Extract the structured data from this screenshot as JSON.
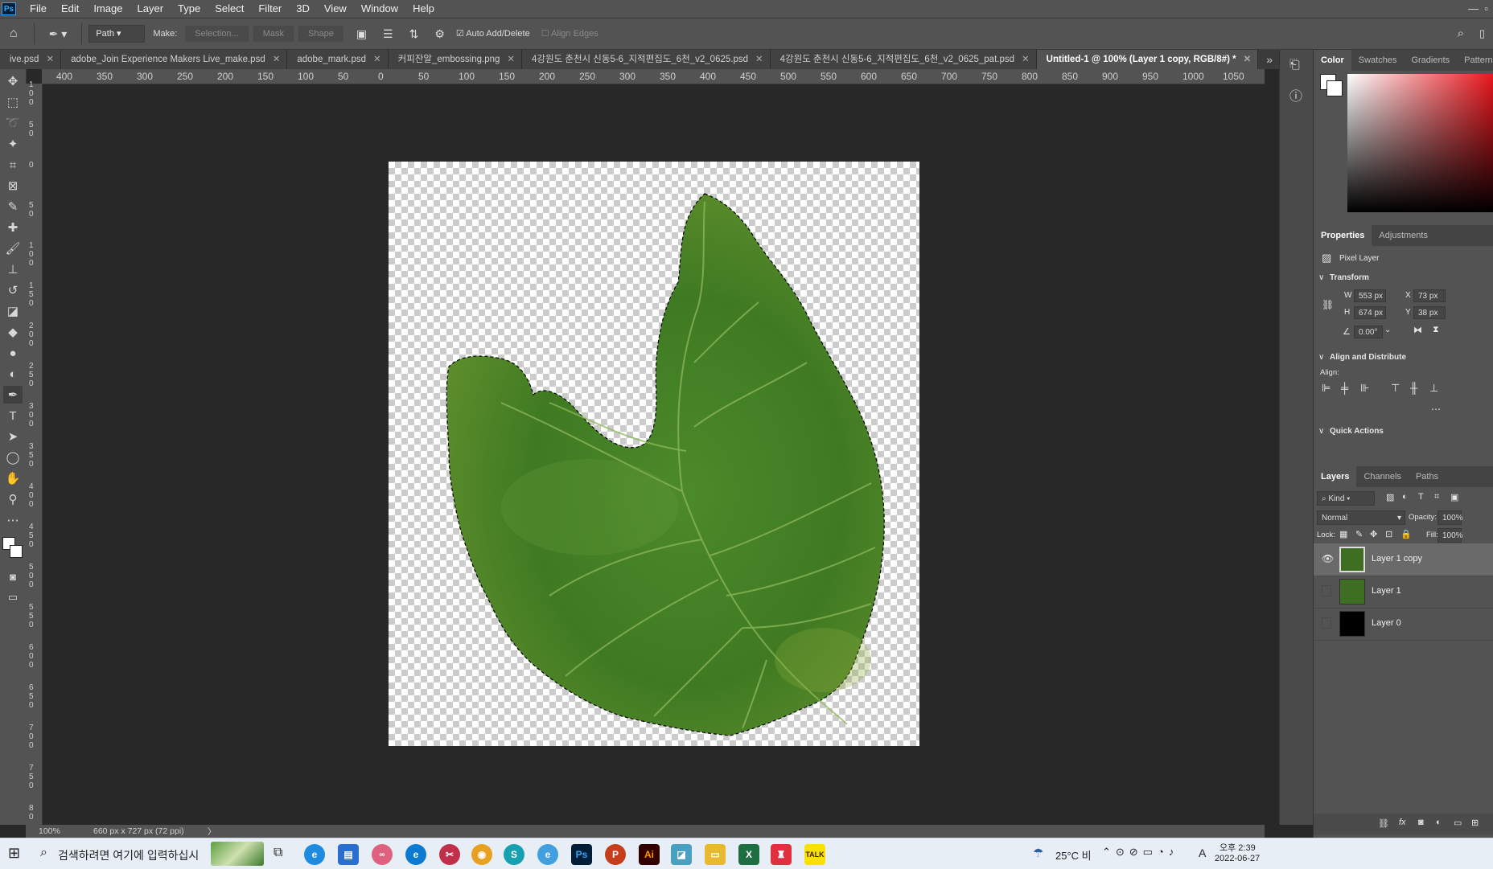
{
  "app": {
    "logo": "Ps"
  },
  "menu": [
    "File",
    "Edit",
    "Image",
    "Layer",
    "Type",
    "Select",
    "Filter",
    "3D",
    "View",
    "Window",
    "Help"
  ],
  "options": {
    "mode": "Path",
    "make_label": "Make:",
    "selection_btn": "Selection...",
    "mask_btn": "Mask",
    "shape_btn": "Shape",
    "auto_add_delete": "Auto Add/Delete",
    "align_edges": "Align Edges"
  },
  "tabs": [
    {
      "label": "ive.psd",
      "active": false
    },
    {
      "label": "adobe_Join Experience Makers Live_make.psd",
      "active": false
    },
    {
      "label": "adobe_mark.psd",
      "active": false
    },
    {
      "label": "커피잔알_embossing.png",
      "active": false
    },
    {
      "label": "4강원도 춘천시 신동5-6_지적편집도_6천_v2_0625.psd",
      "active": false
    },
    {
      "label": "4강원도 춘천시 신동5-6_지적편집도_6천_v2_0625_pat.psd",
      "active": false
    },
    {
      "label": "Untitled-1 @ 100% (Layer 1 copy, RGB/8#) *",
      "active": true
    }
  ],
  "ruler_h": [
    "400",
    "350",
    "300",
    "250",
    "200",
    "150",
    "100",
    "50",
    "0",
    "50",
    "100",
    "150",
    "200",
    "250",
    "300",
    "350",
    "400",
    "450",
    "500",
    "550",
    "600",
    "650",
    "700",
    "750",
    "800",
    "850",
    "900",
    "950",
    "1000",
    "1050"
  ],
  "ruler_v": [
    "1\n0\n0",
    "5\n0",
    "0",
    "5\n0",
    "1\n0\n0",
    "1\n5\n0",
    "2\n0\n0",
    "2\n5\n0",
    "3\n0\n0",
    "3\n5\n0",
    "4\n0\n0",
    "4\n5\n0",
    "5\n0\n0",
    "5\n5\n0",
    "6\n0\n0",
    "6\n5\n0",
    "7\n0\n0",
    "7\n5\n0",
    "8\n0"
  ],
  "status": {
    "zoom": "100%",
    "doc_info": "660 px x 727 px (72 ppi)"
  },
  "color_panel": {
    "tabs": [
      "Color",
      "Swatches",
      "Gradients",
      "Patterns"
    ],
    "fg": "#ffffff",
    "bg": "#ffffff",
    "hue": "#e8161c"
  },
  "properties": {
    "tabs": [
      "Properties",
      "Adjustments"
    ],
    "kind": "Pixel Layer",
    "transform_title": "Transform",
    "w": "553 px",
    "h": "674 px",
    "x": "73 px",
    "y": "38 px",
    "angle": "0.00°",
    "align_title": "Align and Distribute",
    "align_label": "Align:",
    "quick_actions": "Quick Actions",
    "w_label": "W",
    "h_label": "H",
    "x_label": "X",
    "y_label": "Y"
  },
  "layers_panel": {
    "tabs": [
      "Layers",
      "Channels",
      "Paths"
    ],
    "kind": "Kind",
    "blend": "Normal",
    "opacity_label": "Opacity:",
    "opacity": "100%",
    "lock_label": "Lock:",
    "fill_label": "Fill:",
    "fill": "100%",
    "layers": [
      {
        "name": "Layer 1 copy",
        "visible": true,
        "selected": true
      },
      {
        "name": "Layer 1",
        "visible": false,
        "selected": false
      },
      {
        "name": "Layer 0",
        "visible": false,
        "selected": false
      }
    ]
  },
  "taskbar": {
    "search_placeholder": "검색하려면 여기에 입력하십시",
    "weather": "25°C 비",
    "time": "오후 2:39",
    "date": "2022-06-27",
    "ime": "A"
  }
}
